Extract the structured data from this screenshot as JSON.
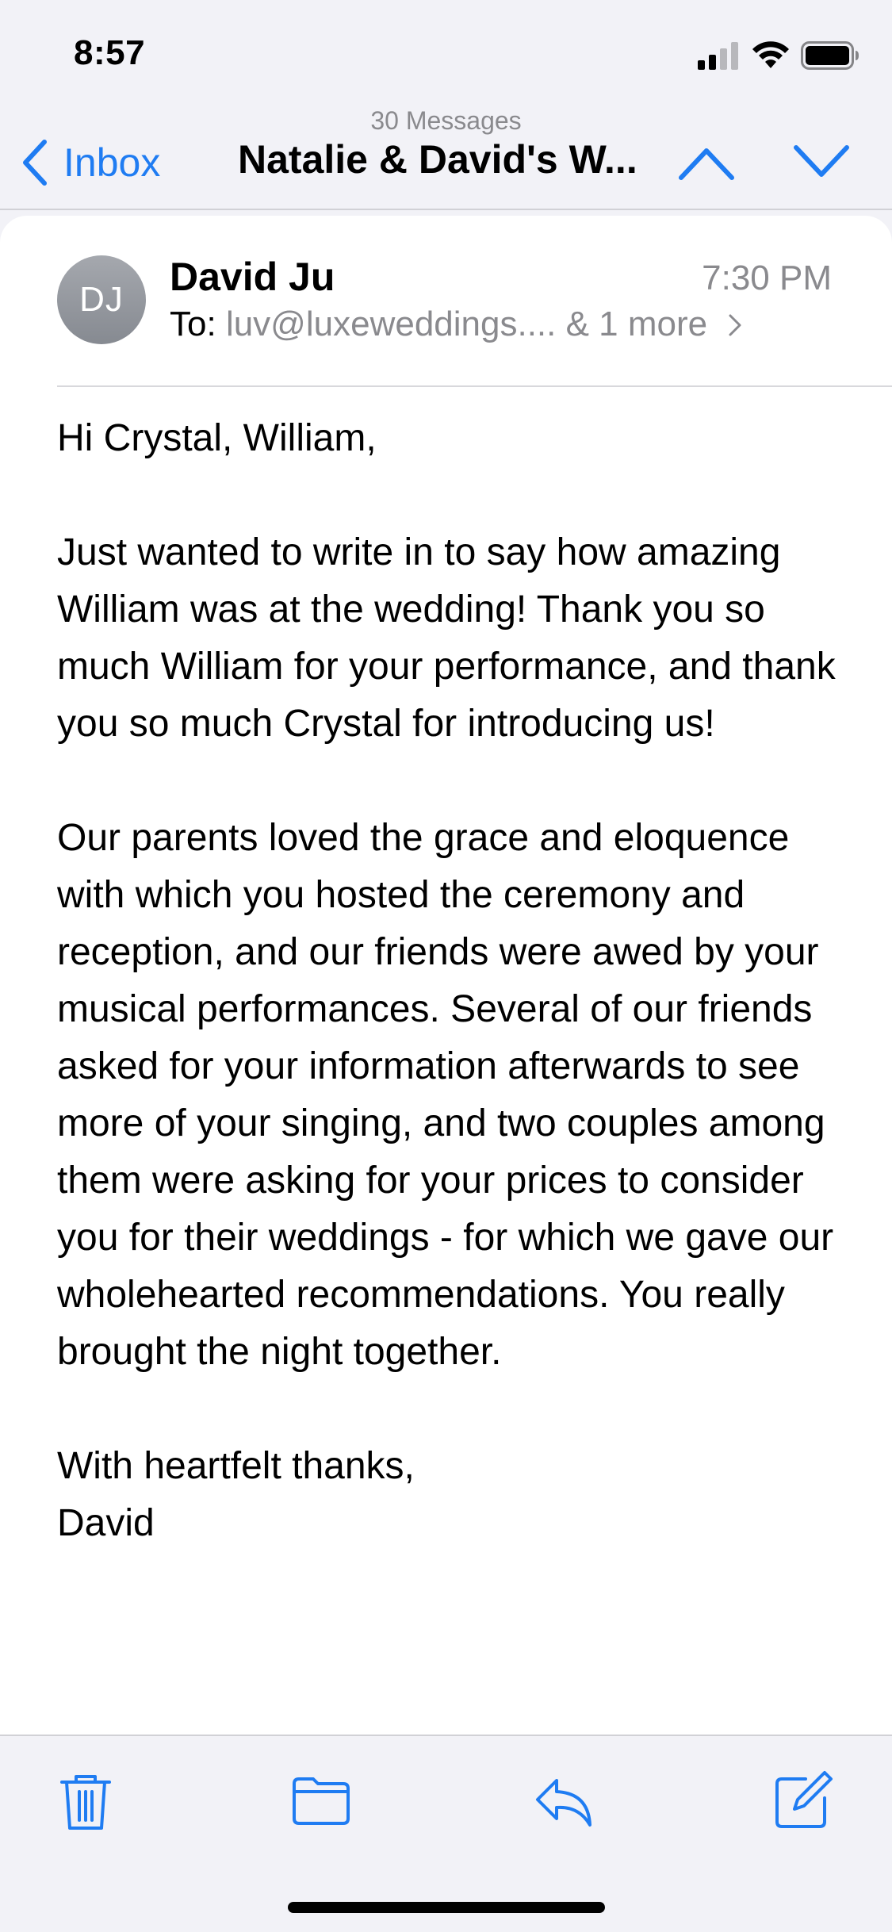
{
  "status_bar": {
    "time": "8:57"
  },
  "nav": {
    "back_label": "Inbox",
    "message_count": "30 Messages",
    "thread_title": "Natalie & David's W..."
  },
  "message": {
    "avatar_initials": "DJ",
    "sender": "David Ju",
    "time": "7:30 PM",
    "to_label": "To:",
    "to_address": "luv@luxeweddings....",
    "to_more": "& 1 more",
    "greeting": "Hi Crystal, William,",
    "paragraph_1": "Just wanted to write in to say how amazing William was at the wedding! Thank you so much William for your performance, and thank you so much Crystal for introducing us!",
    "paragraph_2": "Our parents loved the grace and eloquence with which you hosted the ceremony and reception, and our friends were awed by your musical performances. Several of our friends asked for your information afterwards to see more of your singing, and two couples among them were asking for your prices to consider you for their weddings - for which we gave our wholehearted recommendations. You really brought the night together.",
    "signoff_line_1": "With heartfelt thanks,",
    "signoff_line_2": "David"
  },
  "colors": {
    "accent": "#1f7cf2",
    "secondary_text": "#8a8a8e",
    "background": "#f2f2f7",
    "avatar": "#94979d"
  },
  "icons": [
    "signal-icon",
    "wifi-icon",
    "battery-icon",
    "chevron-left-icon",
    "chevron-up-icon",
    "chevron-down-icon",
    "chevron-right-icon",
    "trash-icon",
    "folder-icon",
    "reply-icon",
    "compose-icon"
  ]
}
